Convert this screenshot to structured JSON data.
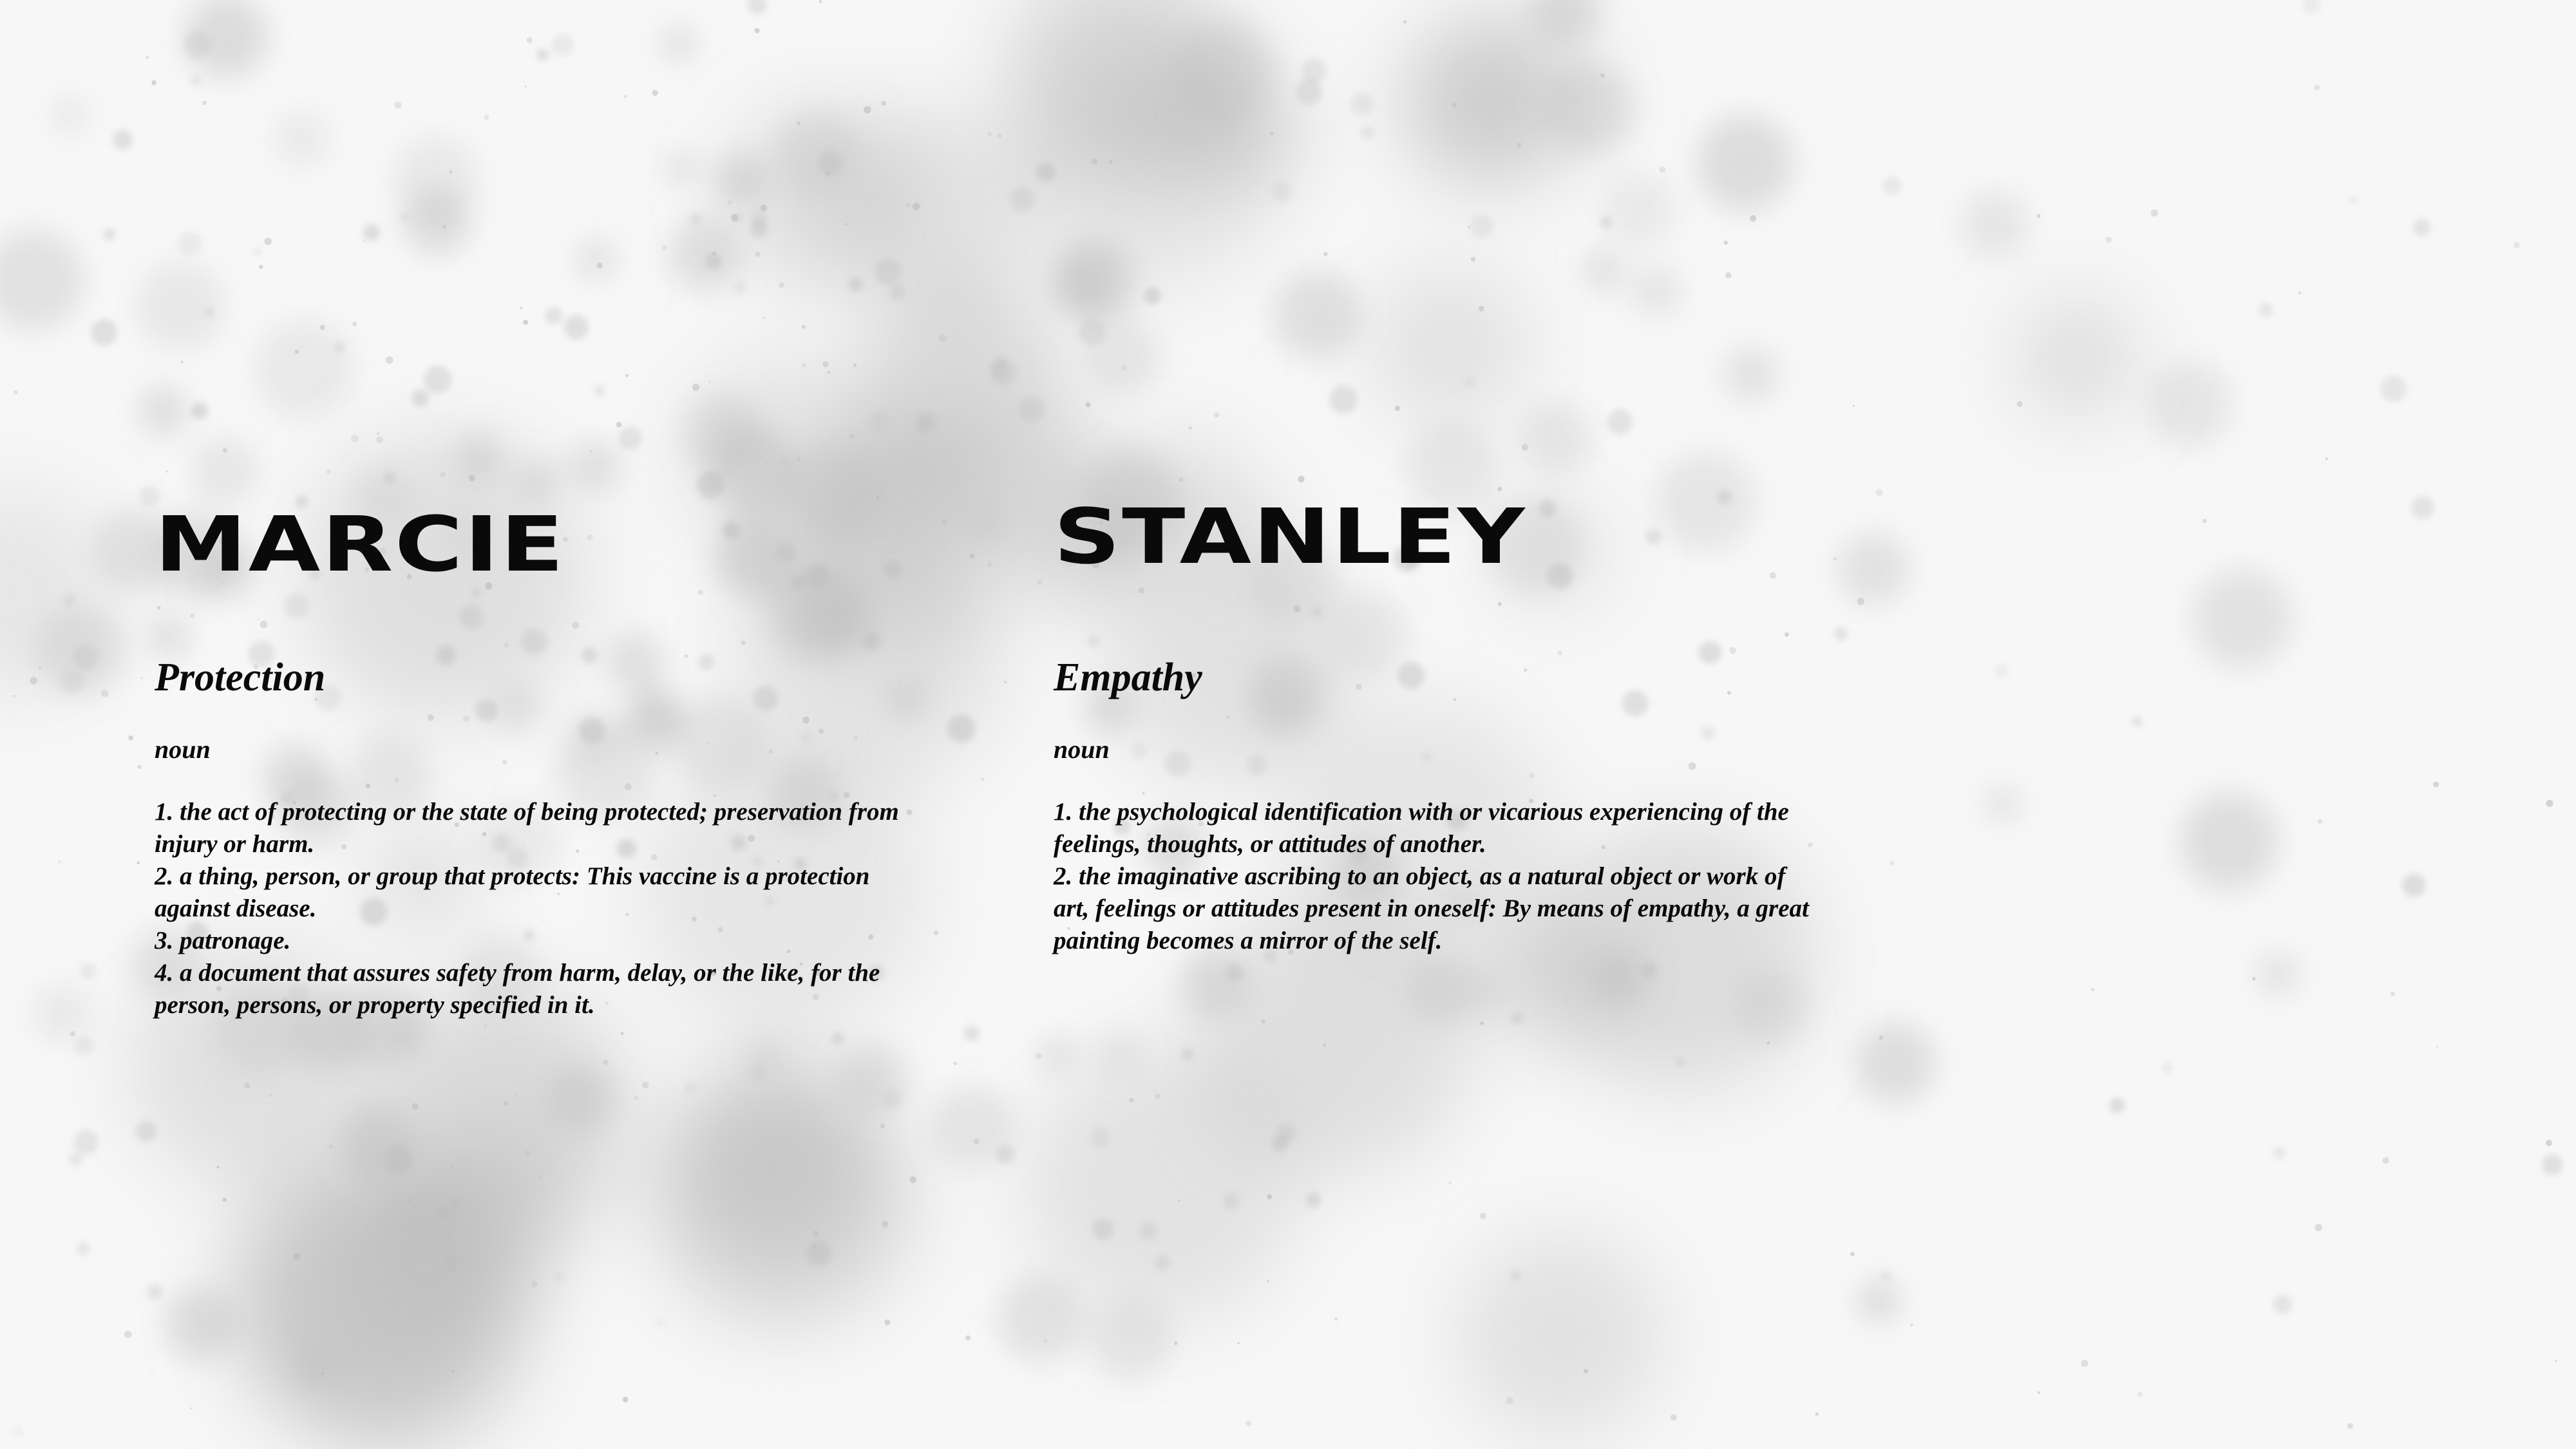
{
  "left": {
    "name": "MARCIE",
    "term": "Protection",
    "part_of_speech": "noun",
    "definitions": [
      "1. the act of protecting or the state of being protected; preservation from injury or harm.",
      "2. a thing, person, or group that protects: This vaccine is a protection against disease.",
      "3. patronage.",
      "4. a document that assures safety from harm, delay, or the like, for the person, persons, or property specified in it."
    ]
  },
  "right": {
    "name": "STANLEY",
    "term": "Empathy",
    "part_of_speech": "noun",
    "definitions": [
      "1. the psychological identification with or vicarious experiencing of the feelings, thoughts, or attitudes of another.",
      "2. the imaginative ascribing to an object, as a natural object or work of art, feelings or attitudes present in oneself: By means of empathy, a great painting becomes a mirror of the self."
    ]
  },
  "background": {
    "base_color": "#f6f6f6",
    "speckle_color": "#b9b9b9"
  }
}
